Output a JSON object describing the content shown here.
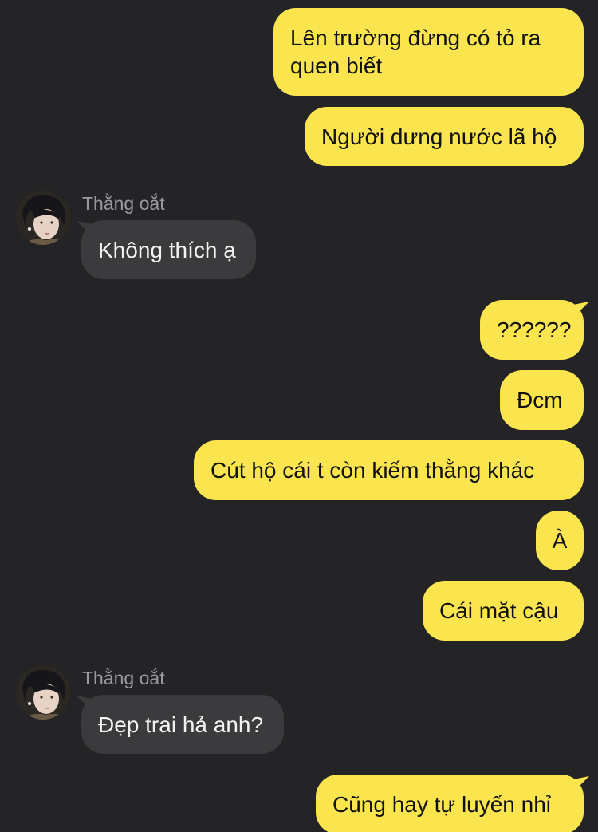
{
  "colors": {
    "background": "#242426",
    "outgoing_bubble": "#fae54f",
    "incoming_bubble": "#3b3b3d",
    "sender_name": "#9a9a9e"
  },
  "messages": [
    {
      "direction": "outgoing",
      "text": "Lên trường đừng có tỏ ra quen biết"
    },
    {
      "direction": "outgoing",
      "text": "Người dưng nước lã hộ"
    },
    {
      "direction": "incoming",
      "sender": "Thằng oắt",
      "text": "Không thích ạ"
    },
    {
      "direction": "outgoing",
      "text": "??????"
    },
    {
      "direction": "outgoing",
      "text": "Đcm"
    },
    {
      "direction": "outgoing",
      "text": "Cút hộ cái t còn kiếm thằng khác"
    },
    {
      "direction": "outgoing",
      "text": "À"
    },
    {
      "direction": "outgoing",
      "text": "Cái mặt cậu"
    },
    {
      "direction": "incoming",
      "sender": "Thằng oắt",
      "text": "Đẹp trai hả anh?"
    },
    {
      "direction": "outgoing",
      "text": "Cũng hay tự luyến nhỉ"
    }
  ],
  "icons": {
    "avatar": "profile-photo-icon"
  }
}
